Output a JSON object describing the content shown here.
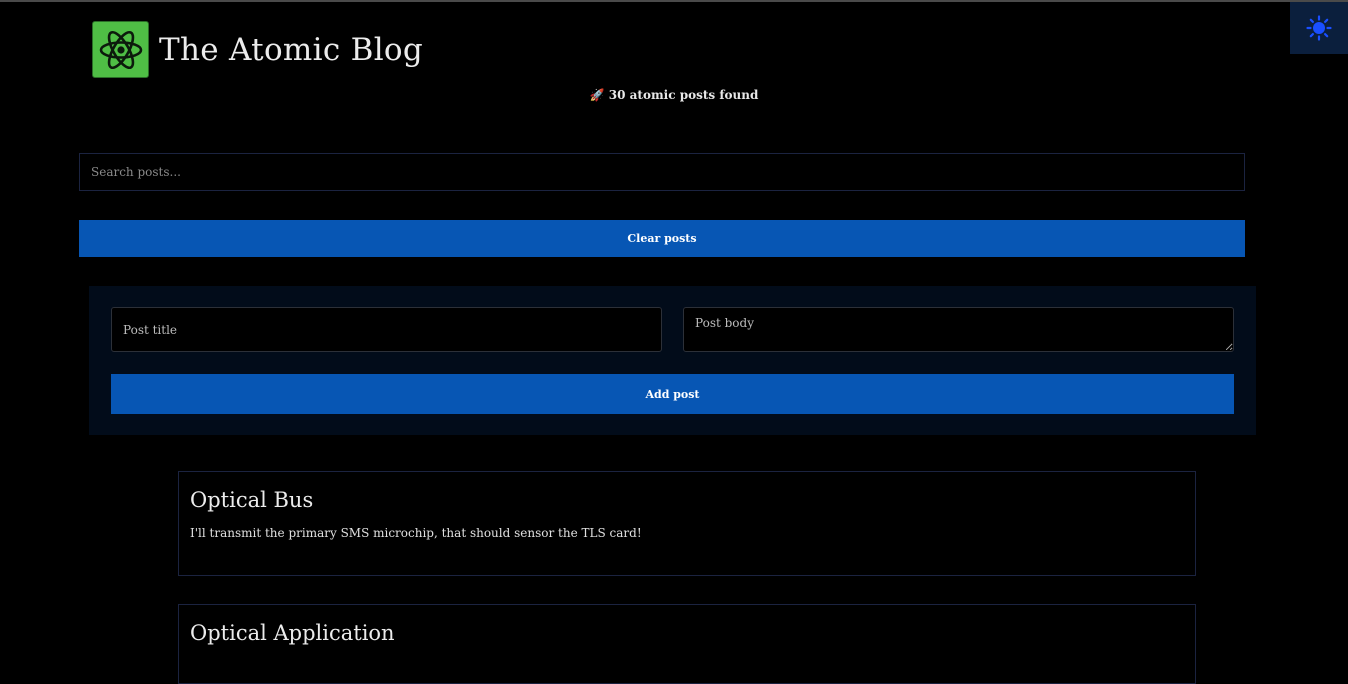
{
  "header": {
    "title": "The Atomic Blog",
    "logo_icon": "atom-icon",
    "logo_color": "#4fbe45"
  },
  "theme_toggle": {
    "icon": "sun-icon",
    "color": "#1a4fff"
  },
  "stats": {
    "icon": "🚀",
    "text": "30 atomic posts found"
  },
  "search": {
    "placeholder": "Search posts...",
    "value": ""
  },
  "clear_button": {
    "label": "Clear posts"
  },
  "form": {
    "title_placeholder": "Post title",
    "body_placeholder": "Post body",
    "submit_label": "Add post"
  },
  "posts": [
    {
      "title": "Optical Bus",
      "body": "I'll transmit the primary SMS microchip, that should sensor the TLS card!"
    },
    {
      "title": "Optical Application",
      "body": ""
    }
  ],
  "colors": {
    "background": "#000000",
    "accent": "#0756b4",
    "panel": "#020c1a"
  }
}
